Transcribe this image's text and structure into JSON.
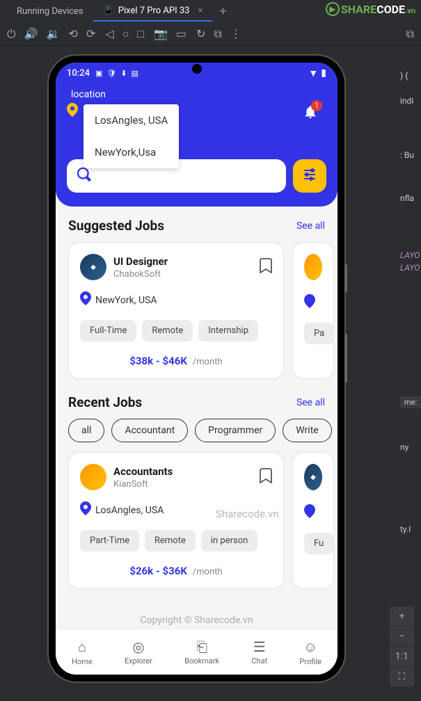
{
  "ide": {
    "tabs": {
      "running_devices": "Running Devices",
      "device": "Pixel 7 Pro API 33"
    },
    "zoom": {
      "one_to_one": "1:1"
    },
    "code_fragments": {
      "brace": ") {",
      "indi": "indi",
      "bu": ": Bu",
      "nfla": "nfla",
      "layo1": "LAYO",
      "layo2": "LAYO",
      "me": "me:",
      "ny": "ny",
      "tyi": "ty.I"
    }
  },
  "watermark": {
    "share": "SHARE",
    "code": "CODE",
    "vn": ".vn",
    "text1": "Sharecode.vn",
    "text2": "Copyright © Sharecode.vn"
  },
  "status_bar": {
    "time": "10:24"
  },
  "header": {
    "location_label": "location",
    "notif_count": "1",
    "dropdown": {
      "opt1": "LosAngles, USA",
      "opt2": "NewYork,Usa"
    }
  },
  "suggested": {
    "title": "Suggested Jobs",
    "see_all": "See all",
    "card1": {
      "title": "UI Designer",
      "company": "ChabokSoft",
      "location": "NewYork, USA",
      "tag1": "Full-Time",
      "tag2": "Remote",
      "tag3": "Internship",
      "salary": "$38k - $46K",
      "period": "/month"
    },
    "card2": {
      "tag1": "Pa"
    }
  },
  "recent": {
    "title": "Recent Jobs",
    "see_all": "See all",
    "chips": {
      "all": "all",
      "accountant": "Accountant",
      "programmer": "Programmer",
      "write": "Write"
    },
    "card1": {
      "title": "Accountants",
      "company": "KianSoft",
      "location": "LosAngles, USA",
      "tag1": "Part-Time",
      "tag2": "Remote",
      "tag3": "in person",
      "salary": "$26k - $36K",
      "period": "/month"
    },
    "card2": {
      "tag1": "Fu"
    }
  },
  "nav": {
    "home": "Home",
    "explorer": "Explorer",
    "bookmark": "Bookmark",
    "chat": "Chat",
    "profile": "Profile"
  }
}
